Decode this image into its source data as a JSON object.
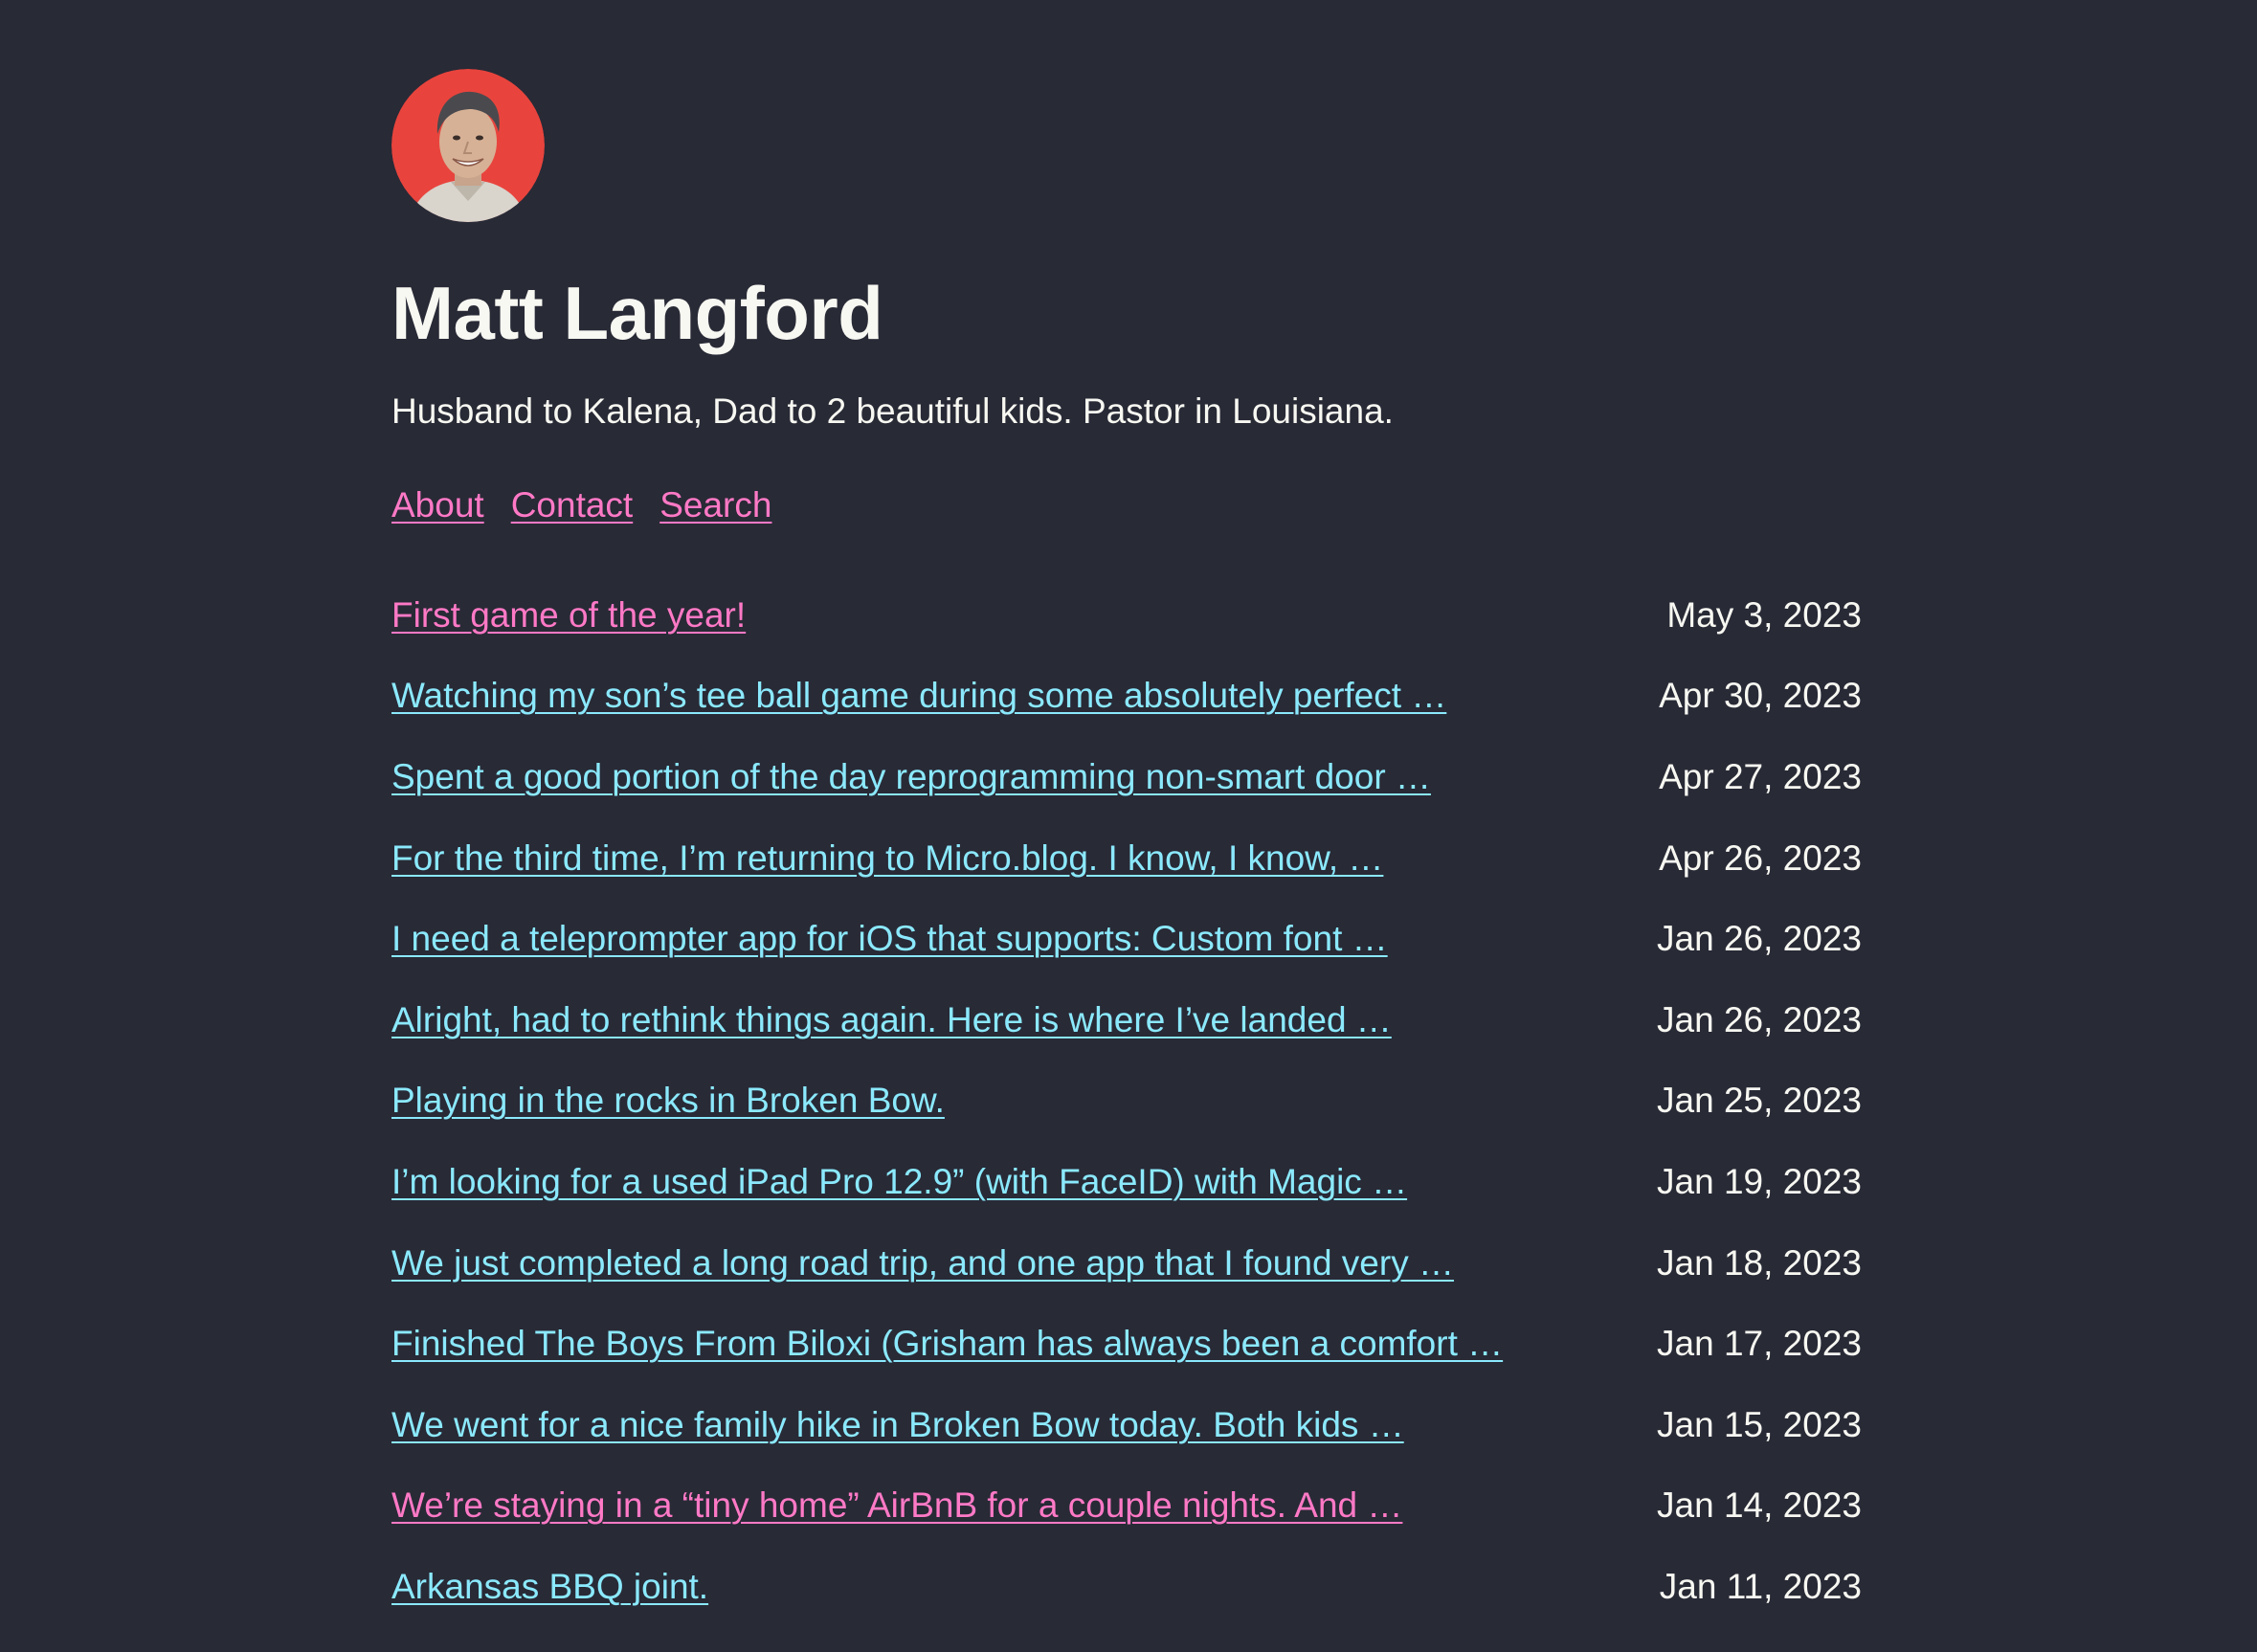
{
  "site": {
    "title": "Matt Langford",
    "bio": "Husband to Kalena, Dad to 2 beautiful kids. Pastor in Louisiana.",
    "avatar_bg": "#e8443d"
  },
  "nav": [
    {
      "label": "About"
    },
    {
      "label": "Contact"
    },
    {
      "label": "Search"
    }
  ],
  "posts": [
    {
      "title": "First game of the year!",
      "date": "May 3, 2023",
      "visited": true
    },
    {
      "title": "Watching my son’s tee ball game during some absolutely perfect …",
      "date": "Apr 30, 2023",
      "visited": false
    },
    {
      "title": "Spent a good portion of the day reprogramming non-smart door …",
      "date": "Apr 27, 2023",
      "visited": false
    },
    {
      "title": "For the third time, I’m returning to Micro.blog. I know, I know, …",
      "date": "Apr 26, 2023",
      "visited": false
    },
    {
      "title": "I need a teleprompter app for iOS that supports: Custom font …",
      "date": "Jan 26, 2023",
      "visited": false
    },
    {
      "title": "Alright, had to rethink things again. Here is where I’ve landed …",
      "date": "Jan 26, 2023",
      "visited": false
    },
    {
      "title": "Playing in the rocks in Broken Bow.",
      "date": "Jan 25, 2023",
      "visited": false
    },
    {
      "title": "I’m looking for a used iPad Pro 12.9” (with FaceID) with Magic …",
      "date": "Jan 19, 2023",
      "visited": false
    },
    {
      "title": "We just completed a long road trip, and one app that I found very …",
      "date": "Jan 18, 2023",
      "visited": false
    },
    {
      "title": "Finished The Boys From Biloxi (Grisham has always been a comfort …",
      "date": "Jan 17, 2023",
      "visited": false
    },
    {
      "title": "We went for a nice family hike in Broken Bow today. Both kids …",
      "date": "Jan 15, 2023",
      "visited": false
    },
    {
      "title": "We’re staying in a “tiny home” AirBnB for a couple nights. And …",
      "date": "Jan 14, 2023",
      "visited": true
    },
    {
      "title": "Arkansas BBQ joint.",
      "date": "Jan 11, 2023",
      "visited": false
    }
  ],
  "colors": {
    "background": "#282a36",
    "text": "#f8f8f2",
    "link": "#8be9fd",
    "link_visited": "#ff79c6"
  }
}
